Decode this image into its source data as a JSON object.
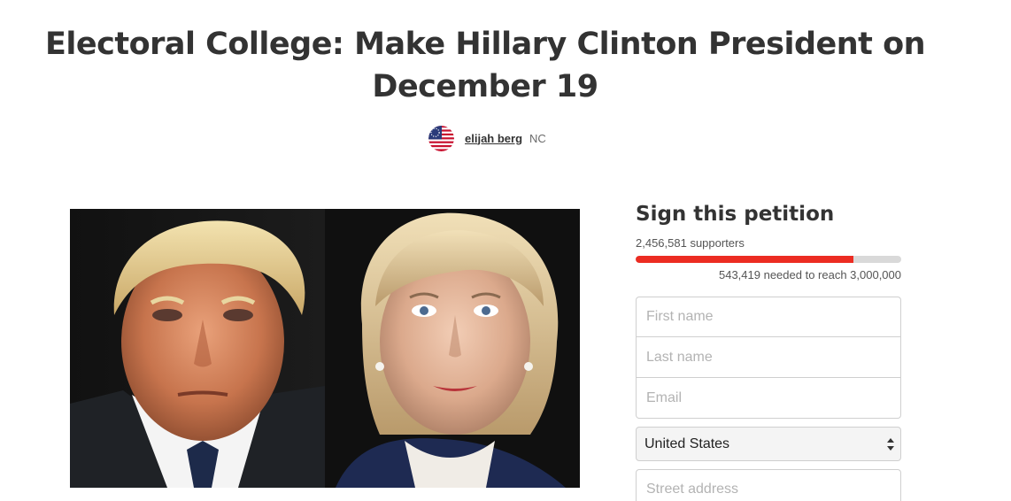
{
  "petition": {
    "title": "Electoral College: Make Hillary Clinton President on December 19"
  },
  "author": {
    "name": "elijah berg",
    "location": "NC",
    "avatar_icon": "us-flag-avatar-icon"
  },
  "media": {
    "icon": "petition-photo-two-portraits"
  },
  "sign": {
    "heading": "Sign this petition",
    "supporters_text": "2,456,581 supporters",
    "supporters": 2456581,
    "goal": 3000000,
    "needed_text": "543,419 needed to reach 3,000,000",
    "progress_color": "#ec2c22",
    "track_color": "#d9d9d9"
  },
  "form": {
    "first_name_placeholder": "First name",
    "last_name_placeholder": "Last name",
    "email_placeholder": "Email",
    "country_value": "United States",
    "street_placeholder": "Street address"
  }
}
